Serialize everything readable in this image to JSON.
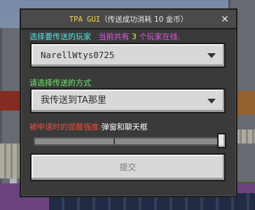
{
  "dialog": {
    "title_prefix": "TPA GUI",
    "title_suffix": "（传送成功消耗 10 金币）",
    "close_glyph": "✕"
  },
  "player_section": {
    "label": "选择要传送的玩家",
    "count_prefix": "当前共有",
    "count_num": "3",
    "count_suffix": "个玩家在线.",
    "selected_player": "NarellWtys0725"
  },
  "method_section": {
    "label": "请选择传送的方式",
    "selected_method": "我传送到TA那里"
  },
  "reminder_section": {
    "label": "被申请时的提醒强度:",
    "value": "弹窗和聊天框",
    "level": 1.0
  },
  "submit_label": "提交",
  "colors": {
    "dialog_bg": "#3a3a3a",
    "title_accent": "#f2d34a",
    "cyan_label": "#5ce6e6",
    "green_label": "#6fe86f",
    "red_label": "#e8503a",
    "count_magenta": "#e05ae0",
    "count_yellow": "#e8e84a"
  },
  "icons": {
    "close": "close-icon",
    "dropdown_arrow": "chevron-down-icon"
  }
}
